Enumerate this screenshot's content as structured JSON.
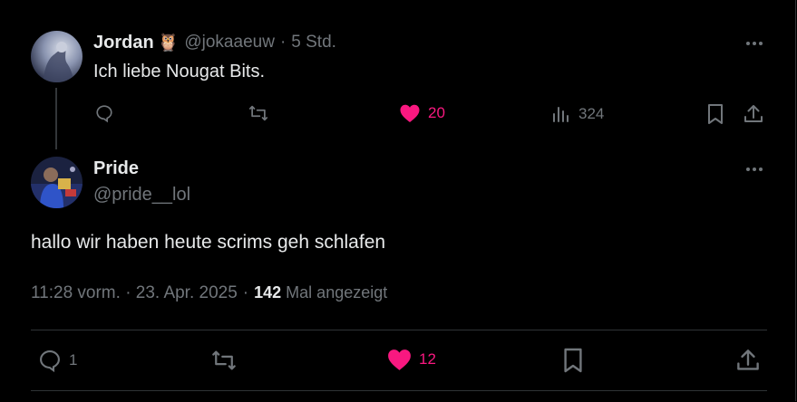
{
  "parent_tweet": {
    "name": "Jordan",
    "emoji": "🦉",
    "handle": "@jokaaeuw",
    "time": "5 Std.",
    "text": "Ich liebe Nougat Bits.",
    "likes": "20",
    "views": "324"
  },
  "main_tweet": {
    "name": "Pride",
    "handle": "@pride__lol",
    "text": "hallo wir haben heute scrims geh schlafen",
    "timestamp": "11:28 vorm. · 23. Apr. 2025",
    "views_count": "142",
    "views_label": "Mal angezeigt",
    "replies": "1",
    "likes": "12"
  },
  "colors": {
    "accent_like": "#f91880",
    "muted": "#71767b",
    "text": "#e7e9ea",
    "border": "#2f3336"
  }
}
